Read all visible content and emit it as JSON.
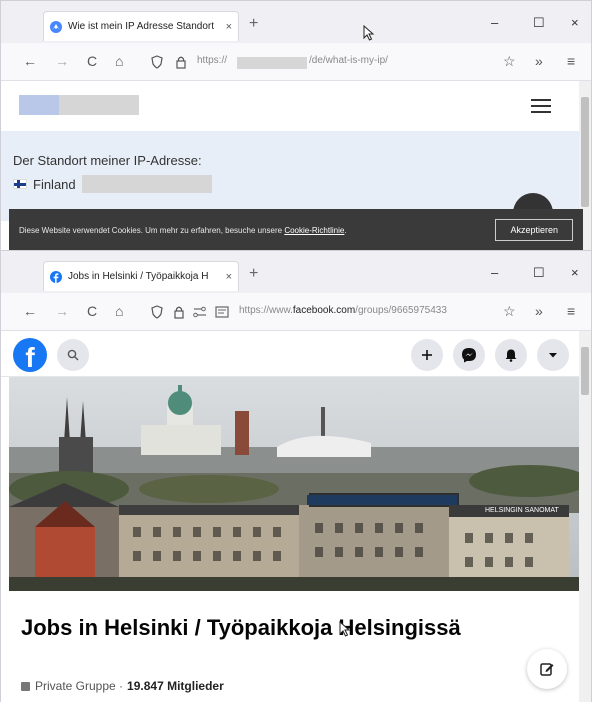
{
  "window1": {
    "tab": {
      "title": "Wie ist mein IP Adresse Standort",
      "close": "×"
    },
    "new_tab": "+",
    "controls": {
      "minimize": "–",
      "maximize": "☐",
      "close": "×"
    },
    "nav": {
      "back": "←",
      "forward": "→",
      "reload": "C",
      "home": "⌂",
      "url_prefix": "https://",
      "url_path": "/de/what-is-my-ip/"
    },
    "page": {
      "ip_label": "Der Standort meiner IP-Adresse:",
      "country": "Finland",
      "cookie_text": "Diese Website verwendet Cookies. Um mehr zu erfahren, besuche unsere ",
      "cookie_link": "Cookie-Richtlinie",
      "cookie_end": ".",
      "accept_button": "Akzeptieren"
    }
  },
  "window2": {
    "tab": {
      "title": "Jobs in Helsinki / Työpaikkoja H",
      "close": "×"
    },
    "new_tab": "+",
    "controls": {
      "minimize": "–",
      "maximize": "☐",
      "close": "×"
    },
    "nav": {
      "back": "←",
      "forward": "→",
      "reload": "C",
      "home": "⌂",
      "url_prefix": "https://www.",
      "url_domain": "facebook.com",
      "url_path": "/groups/9665975433"
    },
    "page": {
      "logo": "f",
      "group_title": "Jobs in Helsinki / Työpaikkoja Helsingissä",
      "privacy": "Private Gruppe ·",
      "members": "19.847 Mitglieder",
      "billboard": "HELSINGIN SANOMAT"
    }
  },
  "toolbar": {
    "star": "☆",
    "overflow": "»",
    "menu": "≡"
  }
}
